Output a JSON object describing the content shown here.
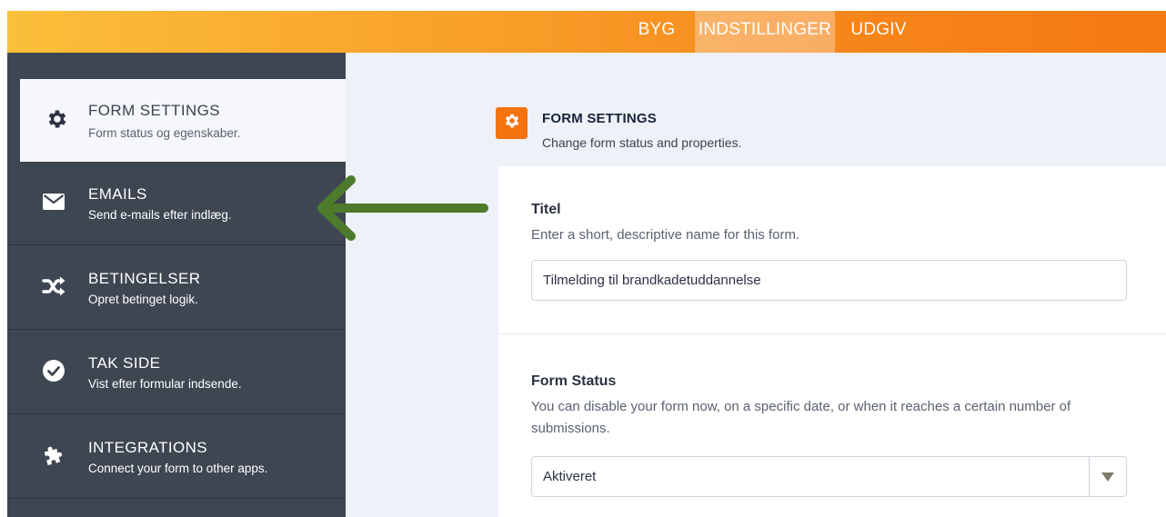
{
  "topnav": {
    "tabs": [
      {
        "label": "BYG"
      },
      {
        "label": "INDSTILLINGER",
        "active": true
      },
      {
        "label": "UDGIV"
      }
    ]
  },
  "sidebar": {
    "items": [
      {
        "title": "FORM SETTINGS",
        "subtitle": "Form status og egenskaber.",
        "icon": "gear-icon",
        "active": true
      },
      {
        "title": "EMAILS",
        "subtitle": "Send e-mails efter indlæg.",
        "icon": "envelope-icon"
      },
      {
        "title": "BETINGELSER",
        "subtitle": "Opret betinget logik.",
        "icon": "shuffle-icon"
      },
      {
        "title": "TAK SIDE",
        "subtitle": "Vist efter formular indsende.",
        "icon": "check-circle-icon"
      },
      {
        "title": "INTEGRATIONS",
        "subtitle": "Connect your form to other apps.",
        "icon": "puzzle-icon"
      }
    ]
  },
  "main": {
    "header": {
      "title": "FORM SETTINGS",
      "subtitle": "Change form status and properties.",
      "icon": "gear-icon"
    },
    "title_field": {
      "label": "Titel",
      "description": "Enter a short, descriptive name for this form.",
      "value": "Tilmelding til brandkadetuddannelse"
    },
    "status_field": {
      "label": "Form Status",
      "description": "You can disable your form now, on a specific date, or when it reaches a certain number of submissions.",
      "value": "Aktiveret"
    }
  },
  "colors": {
    "accent": "#f4730f",
    "sidebar_bg": "#3e4652",
    "arrow": "#4d7a2c"
  }
}
